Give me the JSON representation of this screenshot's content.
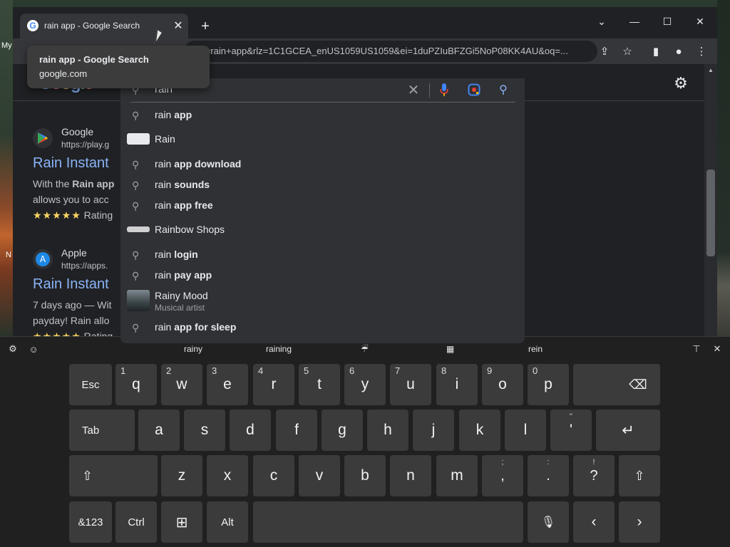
{
  "desktop": {
    "left_label_1": "My",
    "left_label_2": "N"
  },
  "browser": {
    "tab_title": "rain app - Google Search",
    "url": "https://www.google.com/search?q=rain+app&rlz=1C1GCEA_enUS1059US1059&ei=1duPZluBFZGi5NoP08KK4AU&oq=...",
    "url_visible": "n?q=rain+app&rlz=1C1GCEA_enUS1059US1059&ei=1duPZIuBFZGi5NoP08KK4AU&oq=..."
  },
  "hover_card": {
    "title": "rain app - Google Search",
    "domain": "google.com"
  },
  "search": {
    "query": "rain",
    "suggestions": [
      {
        "prefix": "rain",
        "rest": " app",
        "type": "query"
      },
      {
        "text": "Rain",
        "type": "entity"
      },
      {
        "prefix": "rain",
        "rest": " app download",
        "type": "query"
      },
      {
        "prefix": "rain",
        "rest": " sounds",
        "type": "query"
      },
      {
        "prefix": "rain",
        "rest": " app free",
        "type": "query"
      },
      {
        "text": "Rainbow Shops",
        "type": "entity"
      },
      {
        "prefix": "rain",
        "rest": " login",
        "type": "query"
      },
      {
        "prefix": "rain",
        "rest": " pay app",
        "type": "query"
      },
      {
        "text": "Rainy Mood",
        "sub": "Musical artist",
        "type": "entity"
      },
      {
        "prefix": "rain",
        "rest": " app for sleep",
        "type": "query"
      }
    ]
  },
  "results": [
    {
      "site": "Google",
      "url": "https://play.g",
      "title": "Rain Instant",
      "snippet_1_pre": "With the ",
      "snippet_1_bold": "Rain app",
      "snippet_2": "allows you to acc",
      "stars": "★★★★★",
      "rating": "Rating"
    },
    {
      "site": "Apple",
      "url": "https://apps.",
      "title": "Rain Instant",
      "snippet_1_pre": "7 days ago — Wit",
      "snippet_2": "payday! Rain allo",
      "stars": "★★★★★",
      "rating": "Rating"
    }
  ],
  "keyboard": {
    "candidates": [
      "rainy",
      "raining",
      "☔",
      "▦",
      "rein"
    ],
    "row1": [
      {
        "label": "Esc"
      },
      {
        "label": "q",
        "hint": "1"
      },
      {
        "label": "w",
        "hint": "2"
      },
      {
        "label": "e",
        "hint": "3"
      },
      {
        "label": "r",
        "hint": "4"
      },
      {
        "label": "t",
        "hint": "5"
      },
      {
        "label": "y",
        "hint": "6"
      },
      {
        "label": "u",
        "hint": "7"
      },
      {
        "label": "i",
        "hint": "8"
      },
      {
        "label": "o",
        "hint": "9"
      },
      {
        "label": "p",
        "hint": "0"
      },
      {
        "label": "⌫"
      }
    ],
    "row2": [
      {
        "label": "Tab"
      },
      {
        "label": "a"
      },
      {
        "label": "s"
      },
      {
        "label": "d"
      },
      {
        "label": "f"
      },
      {
        "label": "g"
      },
      {
        "label": "h"
      },
      {
        "label": "j"
      },
      {
        "label": "k"
      },
      {
        "label": "l"
      },
      {
        "label": "'",
        "top": "\""
      },
      {
        "label": "↵"
      }
    ],
    "row3": [
      {
        "label": "⇧"
      },
      {
        "label": "z"
      },
      {
        "label": "x"
      },
      {
        "label": "c"
      },
      {
        "label": "v"
      },
      {
        "label": "b"
      },
      {
        "label": "n"
      },
      {
        "label": "m"
      },
      {
        "label": ",",
        "top": ";"
      },
      {
        "label": ".",
        "top": ":"
      },
      {
        "label": "?",
        "top": "!"
      },
      {
        "label": "⇧"
      }
    ],
    "row4": [
      {
        "label": "&123"
      },
      {
        "label": "Ctrl"
      },
      {
        "label": "⊞"
      },
      {
        "label": "Alt"
      },
      {
        "label": ""
      },
      {
        "label": "🎙"
      },
      {
        "label": "‹"
      },
      {
        "label": "›"
      }
    ]
  },
  "icons": {
    "settings": "gear-icon",
    "search": "magnifier-icon",
    "mic": "microphone-icon",
    "lens": "camera-lens-icon"
  },
  "colors": {
    "link": "#8ab4f8",
    "accent_blue": "#4285f4",
    "star": "#fdd663"
  }
}
